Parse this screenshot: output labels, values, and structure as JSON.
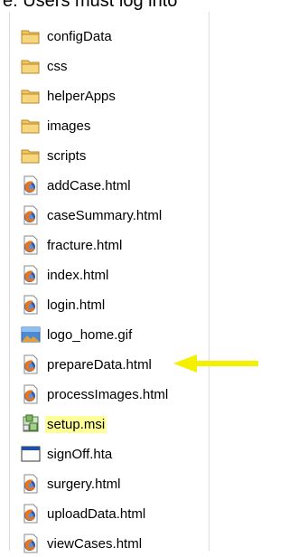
{
  "header_text": "e. Users must log into",
  "items": [
    {
      "label": "configData",
      "icon": "folder-icon"
    },
    {
      "label": "css",
      "icon": "folder-icon"
    },
    {
      "label": "helperApps",
      "icon": "folder-icon"
    },
    {
      "label": "images",
      "icon": "folder-icon"
    },
    {
      "label": "scripts",
      "icon": "folder-icon"
    },
    {
      "label": "addCase.html",
      "icon": "firefox-html-icon"
    },
    {
      "label": "caseSummary.html",
      "icon": "firefox-html-icon"
    },
    {
      "label": "fracture.html",
      "icon": "firefox-html-icon"
    },
    {
      "label": "index.html",
      "icon": "firefox-html-icon"
    },
    {
      "label": "login.html",
      "icon": "firefox-html-icon"
    },
    {
      "label": "logo_home.gif",
      "icon": "image-file-icon"
    },
    {
      "label": "prepareData.html",
      "icon": "firefox-html-icon"
    },
    {
      "label": "processImages.html",
      "icon": "firefox-html-icon"
    },
    {
      "label": "setup.msi",
      "icon": "msi-installer-icon",
      "highlighted": true
    },
    {
      "label": "signOff.hta",
      "icon": "hta-window-icon"
    },
    {
      "label": "surgery.html",
      "icon": "firefox-html-icon"
    },
    {
      "label": "uploadData.html",
      "icon": "firefox-html-icon"
    },
    {
      "label": "viewCases.html",
      "icon": "firefox-html-icon"
    }
  ],
  "colors": {
    "highlight": "#ffff99",
    "arrow": "#f5f000",
    "folder": "#f2c75c"
  }
}
